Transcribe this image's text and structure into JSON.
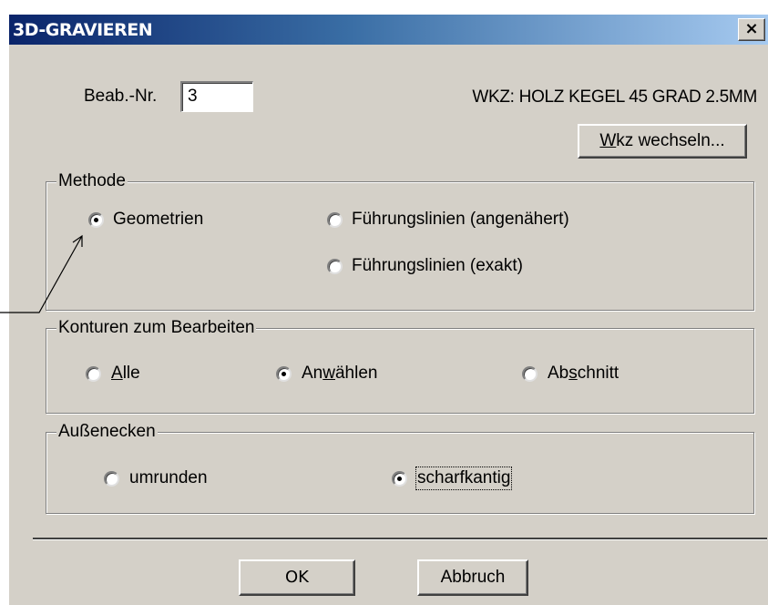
{
  "window": {
    "title": "3D-GRAVIEREN",
    "close_glyph": "×"
  },
  "job": {
    "label": "Beab.-Nr.",
    "value": "3",
    "tool_text": "WKZ: HOLZ KEGEL 45 GRAD 2.5MM",
    "change_tool_button": {
      "mnemonic": "W",
      "rest": "kz wechseln..."
    }
  },
  "methode": {
    "title": "Methode",
    "options": [
      {
        "label": "Geometrien",
        "checked": true
      },
      {
        "label": "Führungslinien (angenähert)",
        "checked": false
      },
      {
        "label": "Führungslinien (exakt)",
        "checked": false
      }
    ]
  },
  "konturen": {
    "title": "Konturen zum Bearbeiten",
    "options": [
      {
        "pre": "",
        "mnemonic": "A",
        "post": "lle",
        "checked": false
      },
      {
        "pre": "An",
        "mnemonic": "w",
        "post": "ählen",
        "checked": true
      },
      {
        "pre": "Ab",
        "mnemonic": "s",
        "post": "chnitt",
        "checked": false
      }
    ]
  },
  "aussenecken": {
    "title": "Außenecken",
    "options": [
      {
        "label": "umrunden",
        "checked": false
      },
      {
        "label": "scharfkantig",
        "checked": true
      }
    ]
  },
  "buttons": {
    "ok": "OK",
    "cancel": "Abbruch"
  }
}
